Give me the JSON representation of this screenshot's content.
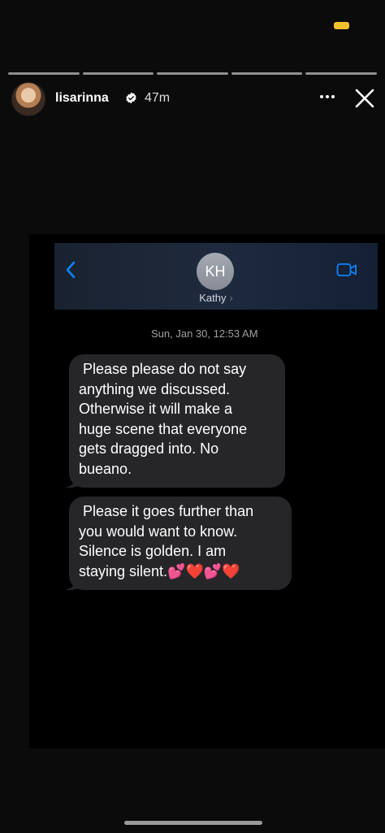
{
  "story": {
    "username": "lisarinna",
    "time_ago": "47m",
    "segments": 5
  },
  "icons": {
    "verified": "verified-badge-icon",
    "more": "more-dots-icon",
    "close": "close-x-icon",
    "back": "chevron-left-icon",
    "video": "video-camera-icon"
  },
  "screenshot": {
    "contact": {
      "initials": "KH",
      "name": "Kathy",
      "chevron": "›"
    },
    "timestamp": "Sun, Jan 30, 12:53 AM",
    "messages": [
      {
        "lines": [
          " Please please do not say",
          "anything we discussed.",
          "Otherwise it will make a",
          "huge scene that everyone",
          "gets dragged into. No",
          "bueano."
        ]
      },
      {
        "lines": [
          " Please it goes further than",
          "you would want to know.",
          "Silence is golden. I am",
          "staying silent.💕❤️💕❤️"
        ]
      }
    ]
  },
  "colors": {
    "background": "#0b0b0c",
    "bubble": "#262629",
    "ios_blue": "#0a84ff",
    "status_indicator": "#f2c12e"
  }
}
